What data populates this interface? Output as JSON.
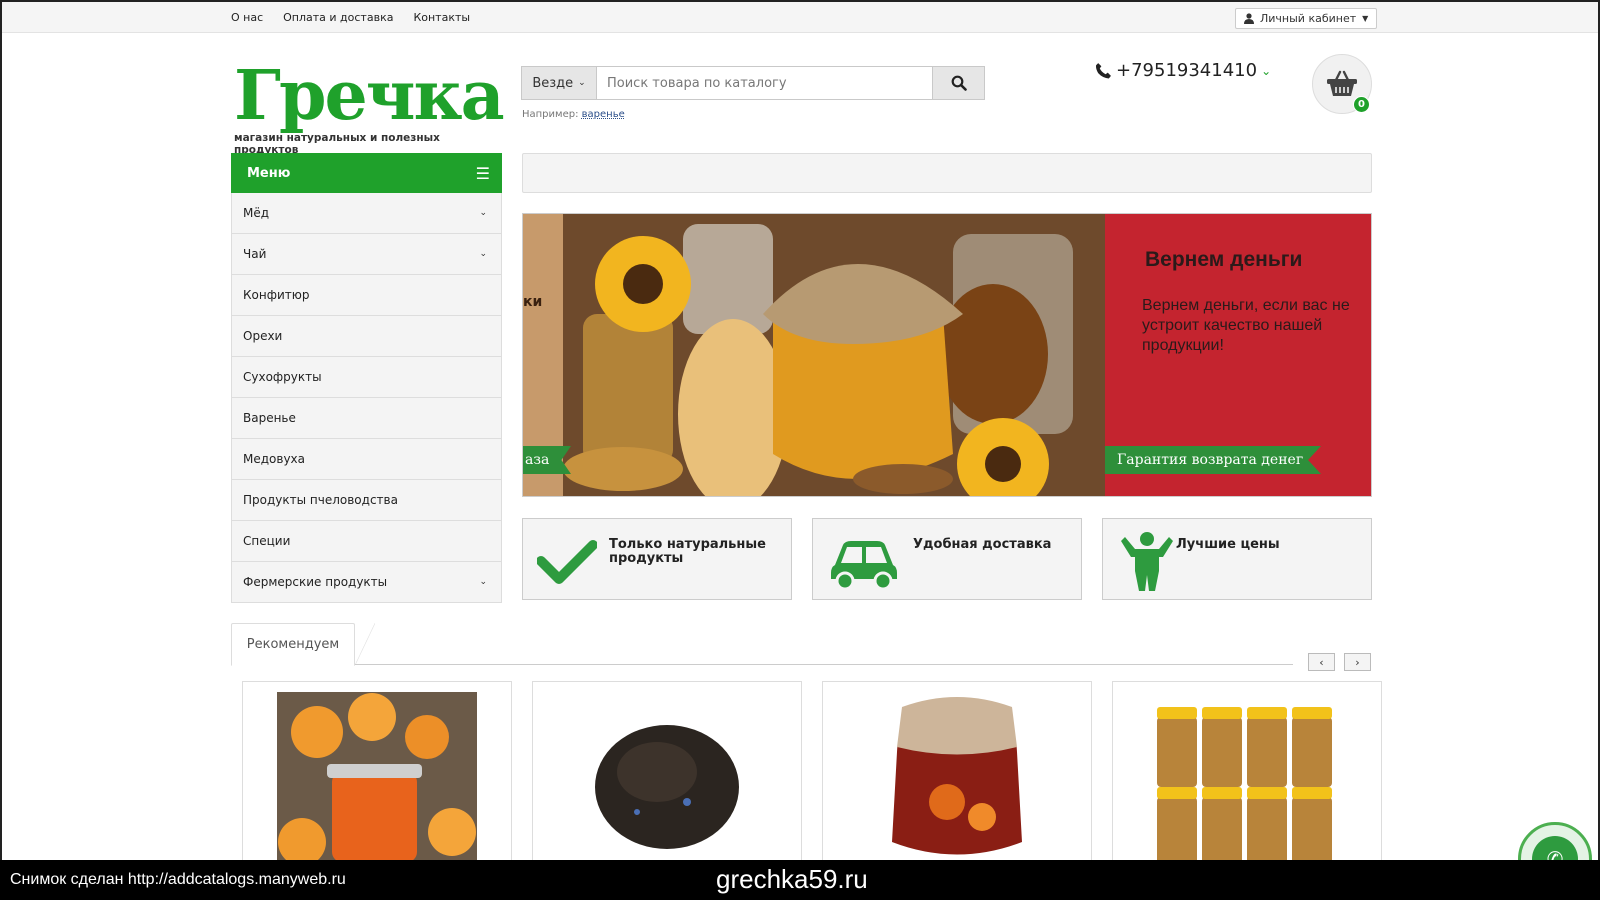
{
  "topbar": {
    "links": [
      "О нас",
      "Оплата и доставка",
      "Контакты"
    ],
    "account_label": "Личный кабинет"
  },
  "logo": {
    "wordmark": "Гречка",
    "tagline": "магазин натуральных и полезных продуктов"
  },
  "search": {
    "scope": "Везде",
    "placeholder": "Поиск товара по каталогу",
    "example_prefix": "Например:",
    "example_link": "варенье"
  },
  "phone": "+79519341410",
  "cart": {
    "count": "0"
  },
  "menu": {
    "title": "Меню",
    "items": [
      {
        "label": "Мёд",
        "has_sub": true
      },
      {
        "label": "Чай",
        "has_sub": true
      },
      {
        "label": "Конфитюр",
        "has_sub": false
      },
      {
        "label": "Орехи",
        "has_sub": false
      },
      {
        "label": "Сухофрукты",
        "has_sub": false
      },
      {
        "label": "Варенье",
        "has_sub": false
      },
      {
        "label": "Медовуха",
        "has_sub": false
      },
      {
        "label": "Продукты пчеловодства",
        "has_sub": false
      },
      {
        "label": "Специи",
        "has_sub": false
      },
      {
        "label": "Фермерские продукты",
        "has_sub": true
      }
    ]
  },
  "slider": {
    "title": "Вернем деньги",
    "text": "Вернем деньги, если вас не устроит качество нашей продукции!",
    "ribbon": "Гарантия возврата денег",
    "prev_ribbon_fragment": "аза",
    "prev_text_fragment": "ки",
    "dots_count": 7,
    "active_dot": 1
  },
  "features": [
    {
      "label": "Только натуральные продукты",
      "icon": "checkmark-icon"
    },
    {
      "label": "Удобная доставка",
      "icon": "car-icon"
    },
    {
      "label": "Лучшие цены",
      "icon": "person-icon"
    }
  ],
  "recommend_tab": "Рекомендуем",
  "products": [
    {
      "name": "apricot-jam"
    },
    {
      "name": "black-tea"
    },
    {
      "name": "jam-jar"
    },
    {
      "name": "honey-nuts"
    }
  ],
  "footer": {
    "left": "Снимок сделан http://addcatalogs.manyweb.ru",
    "center": "grechka59.ru"
  },
  "colors": {
    "brand_green": "#1fa12b",
    "slider_red": "#c4242f"
  }
}
